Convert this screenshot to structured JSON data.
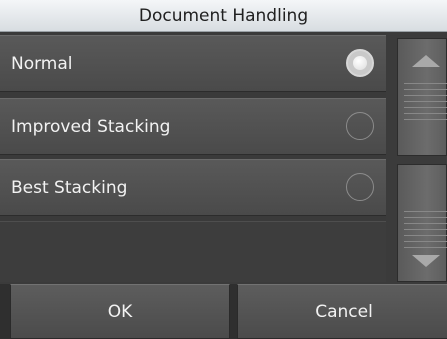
{
  "dialog": {
    "title": "Document Handling"
  },
  "options": [
    {
      "label": "Normal",
      "selected": true
    },
    {
      "label": "Improved Stacking",
      "selected": false
    },
    {
      "label": "Best Stacking",
      "selected": false
    }
  ],
  "buttons": {
    "ok_label": "OK",
    "cancel_label": "Cancel"
  },
  "icons": {
    "scroll_up": "triangle-up-icon",
    "scroll_down": "triangle-down-icon",
    "radio_selected": "radio-selected-icon",
    "radio_unselected": "radio-unselected-icon"
  },
  "colors": {
    "title_bar": "#e6e9ec",
    "panel": "#3b3b3b",
    "option_bg": "#525252",
    "text": "#f2f2f2"
  }
}
